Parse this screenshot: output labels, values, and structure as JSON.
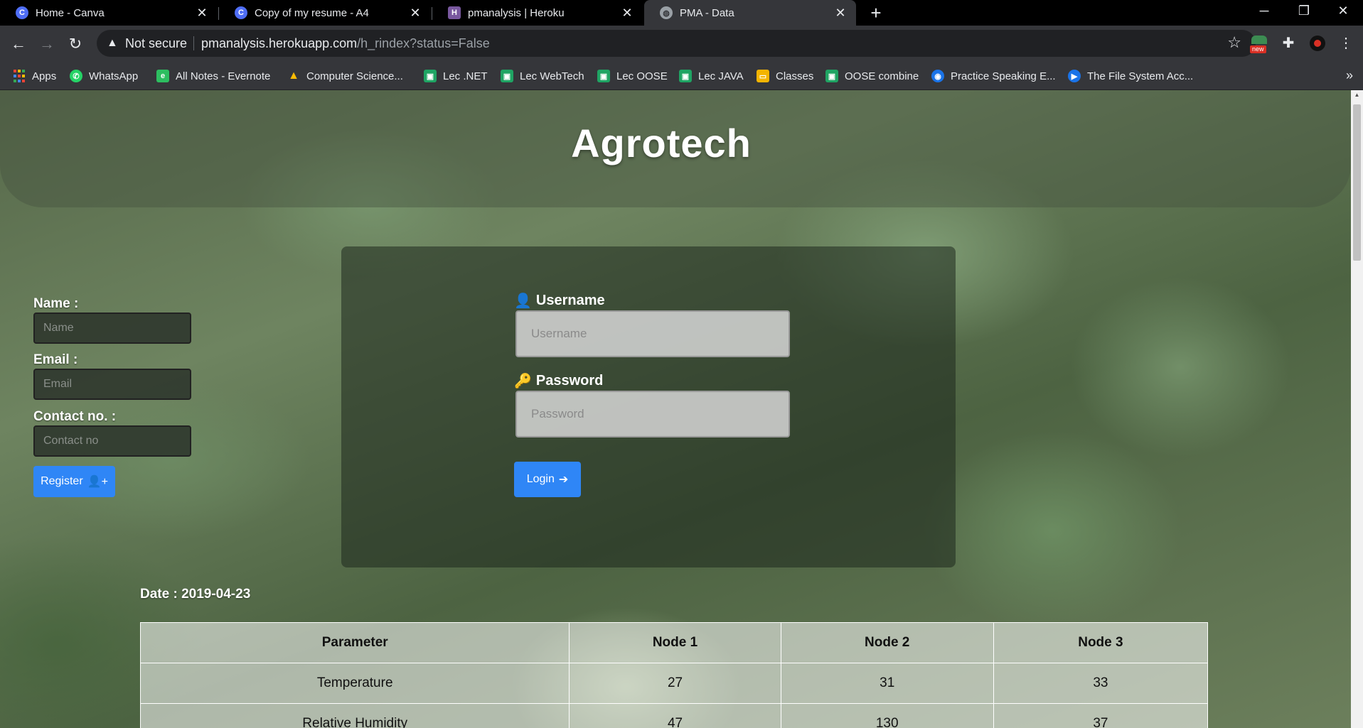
{
  "browser": {
    "tabs": [
      {
        "title": "Home - Canva",
        "icon": "canva-icon",
        "color": "#4f6ef7",
        "glyph": "C"
      },
      {
        "title": "Copy of my resume - A4",
        "icon": "canva-icon",
        "color": "#4f6ef7",
        "glyph": "C"
      },
      {
        "title": "pmanalysis | Heroku",
        "icon": "heroku-icon",
        "color": "#79589f",
        "glyph": "H"
      },
      {
        "title": "PMA - Data",
        "icon": "globe-icon",
        "color": "#9aa0a6",
        "glyph": "◍"
      }
    ],
    "security_text": "Not secure",
    "url_host": "pmanalysis.herokuapp.com",
    "url_path": "/h_rindex?status=False",
    "extension_badge": "new",
    "bookmarks": [
      {
        "label": "Apps",
        "color": "#ea4335"
      },
      {
        "label": "WhatsApp",
        "color": "#25d366"
      },
      {
        "label": "All Notes - Evernote",
        "color": "#2dbe60"
      },
      {
        "label": "Computer Science...",
        "color": "#fbbc04"
      },
      {
        "label": "Lec .NET",
        "color": "#1fa463"
      },
      {
        "label": "Lec WebTech",
        "color": "#1fa463"
      },
      {
        "label": "Lec OOSE",
        "color": "#1fa463"
      },
      {
        "label": "Lec JAVA",
        "color": "#1fa463"
      },
      {
        "label": "Classes",
        "color": "#f4b400"
      },
      {
        "label": "OOSE combine",
        "color": "#1fa463"
      },
      {
        "label": "Practice Speaking E...",
        "color": "#1a73e8"
      },
      {
        "label": "The File System Acc...",
        "color": "#1a73e8"
      }
    ],
    "bookmarks_more": "»"
  },
  "page": {
    "brand": "Agrotech",
    "register": {
      "name_label": "Name :",
      "name_placeholder": "Name",
      "email_label": "Email :",
      "email_placeholder": "Email",
      "contact_label": "Contact no. :",
      "contact_placeholder": "Contact no",
      "button_label": "Register"
    },
    "login": {
      "username_label": "Username",
      "username_placeholder": "Username",
      "password_label": "Password",
      "password_placeholder": "Password",
      "button_label": "Login"
    },
    "date_text": "Date : 2019-04-23",
    "table": {
      "headers": [
        "Parameter",
        "Node 1",
        "Node 2",
        "Node 3"
      ],
      "rows": [
        [
          "Temperature",
          "27",
          "31",
          "33"
        ],
        [
          "Relative Humidity",
          "47",
          "130",
          "37"
        ]
      ]
    }
  }
}
